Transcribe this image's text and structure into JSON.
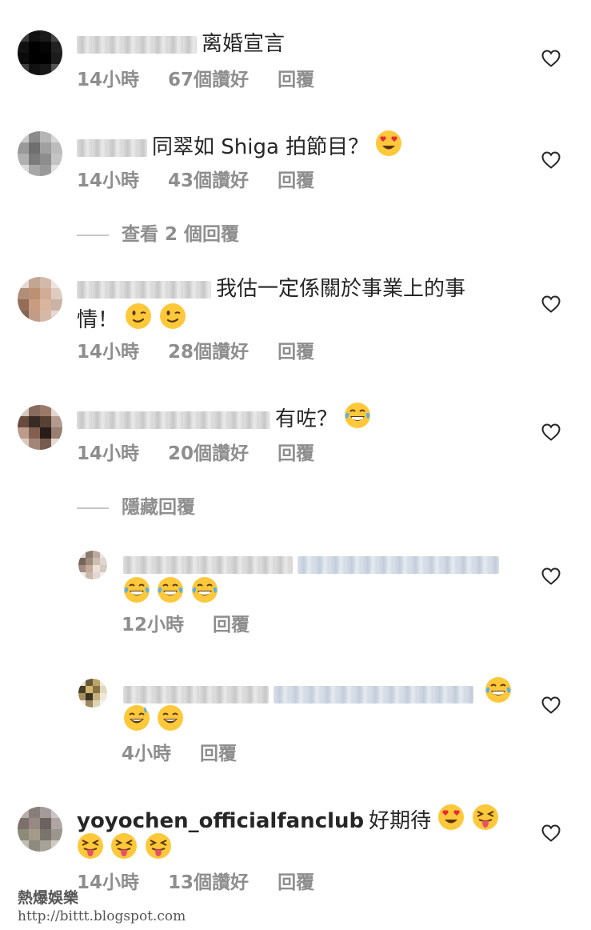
{
  "comments": [
    {
      "text": "离婚宣言",
      "time": "14小時",
      "likes": "67個讚好",
      "reply": "回覆"
    },
    {
      "text": "同翠如 Shiga 拍節目？",
      "emoji": [
        "heart-eyes"
      ],
      "time": "14小時",
      "likes": "43個讚好",
      "reply": "回覆",
      "view_replies": "查看 2 個回覆"
    },
    {
      "text_line1": "我估一定係關於事業上的事",
      "text_line2": "情！",
      "emoji": [
        "wink",
        "wink"
      ],
      "time": "14小時",
      "likes": "28個讚好",
      "reply": "回覆"
    },
    {
      "text": "有咗？",
      "emoji": [
        "laugh-tears"
      ],
      "time": "14小時",
      "likes": "20個讚好",
      "reply": "回覆",
      "hide_replies": "隱藏回覆"
    }
  ],
  "replies": [
    {
      "emoji": [
        "laugh-tears",
        "laugh-tears",
        "laugh-tears"
      ],
      "time": "12小時",
      "reply": "回覆"
    },
    {
      "emoji": [
        "laugh-tears",
        "grin-sweat",
        "grin"
      ],
      "time": "4小時",
      "reply": "回覆"
    }
  ],
  "last_comment": {
    "username": "yoyochen_officialfanclub",
    "text": "好期待",
    "emoji": [
      "heart-eyes",
      "tongue-wink",
      "tongue-wink",
      "tongue-wink",
      "tongue-wink"
    ],
    "time": "14小時",
    "likes": "13個讚好",
    "reply": "回覆"
  },
  "watermark": {
    "title": "熱爆娛樂",
    "url": "http://bittt.blogspot.com"
  },
  "colors": {
    "text": "#262626",
    "meta": "#8e8e8e",
    "emoji_face": "#fdc83a",
    "heart_eye": "#e8283c"
  }
}
